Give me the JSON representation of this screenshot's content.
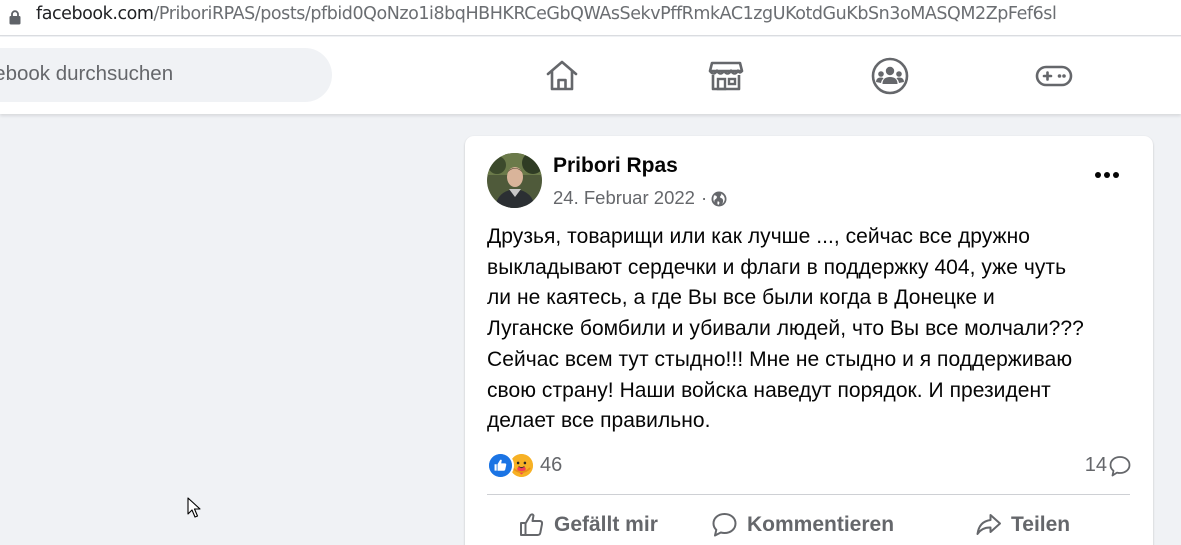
{
  "browser": {
    "url_domain": "facebook.com",
    "url_path": "/PriboriRPAS/posts/pfbid0QoNzo1i8bqHBHKRCeGbQWAsSekvPffRmkAC1zgUKotdGuKbSn3oMASQM2ZpFef6sl",
    "lock_icon": "lock-icon"
  },
  "header": {
    "search_placeholder": "Facebook durchsuchen",
    "nav_icons": [
      "home-icon",
      "marketplace-icon",
      "groups-icon",
      "gaming-icon"
    ]
  },
  "post": {
    "author": "Pribori Rpas",
    "date": "24. Februar 2022",
    "separator": "·",
    "audience_icon": "globe-icon",
    "message_lines": [
      "Друзья, товарищи или как лучше ..., сейчас все дружно",
      "выкладывают сердечки и флаги в поддержку 404, уже чуть",
      "ли не каятесь, а где Вы все были когда в Донецке и",
      "Луганске бомбили и убивали людей, что Вы все молчали???",
      "Сейчас всем тут стыдно!!! Мне не стыдно и я поддерживаю",
      "свою страну! Наши войска наведут порядок. И президент",
      "делает все правильно."
    ],
    "reaction_count": "46",
    "reaction_icons": [
      "like-reaction-icon",
      "care-reaction-icon"
    ],
    "comment_count": "14",
    "actions": {
      "like": "Gefällt mir",
      "comment": "Kommentieren",
      "share": "Teilen"
    }
  },
  "colors": {
    "page_background": "#f0f2f5",
    "card_background": "#ffffff",
    "facebook_blue": "#1b74e4",
    "secondary_text": "#65676b",
    "primary_text": "#050505"
  }
}
